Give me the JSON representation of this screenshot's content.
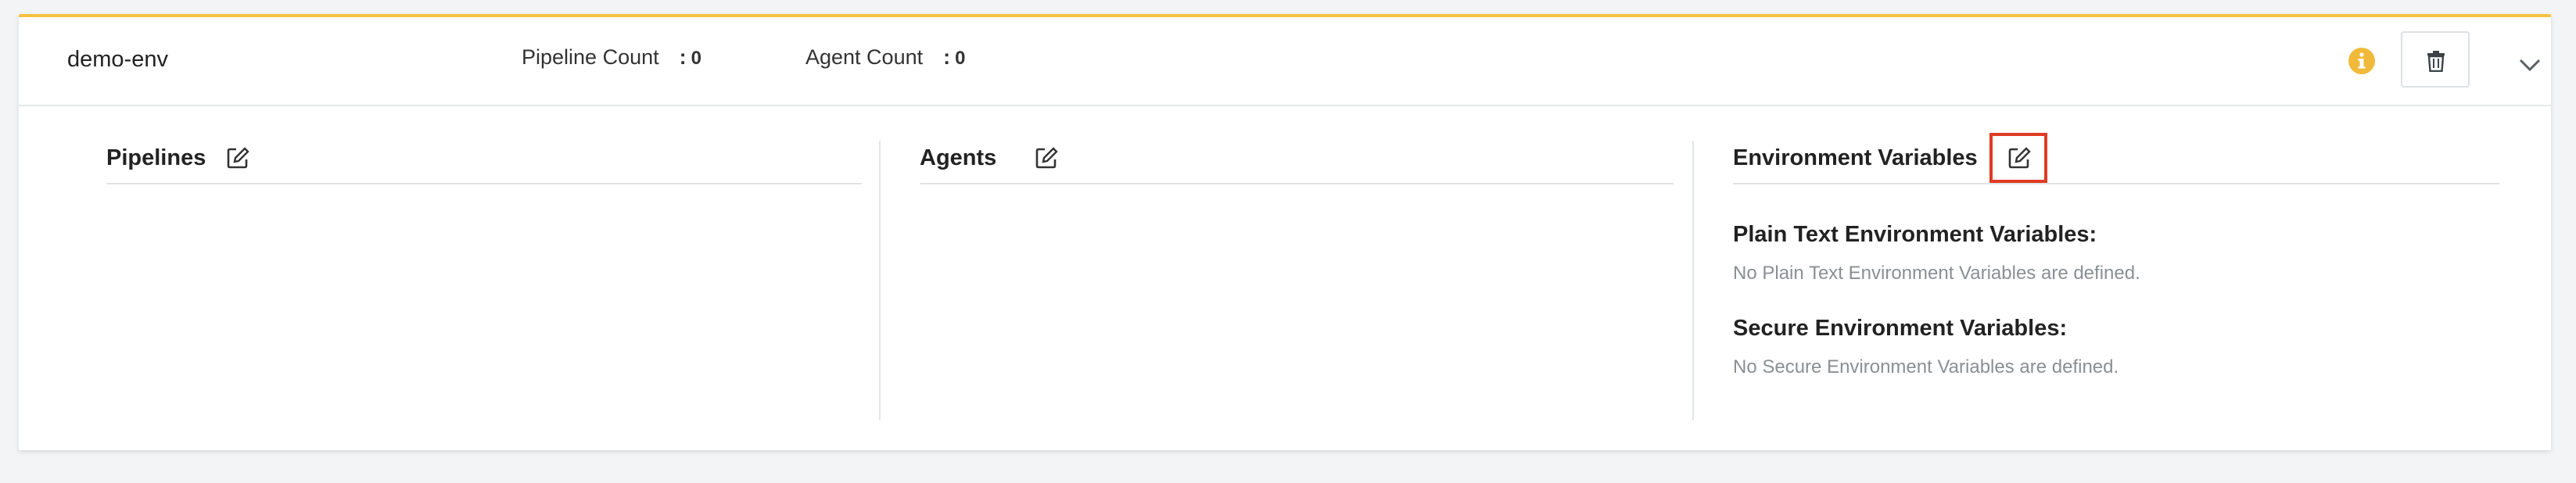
{
  "environment": {
    "name": "demo-env",
    "pipeline_count_label": "Pipeline Count",
    "pipeline_count_value": "0",
    "agent_count_label": "Agent Count",
    "agent_count_value": "0",
    "separator": ":"
  },
  "icons": {
    "info": "info-icon",
    "delete": "trash-icon",
    "collapse": "chevron-down-icon",
    "edit": "edit-icon"
  },
  "colors": {
    "accent_border": "#f5c242",
    "info_icon": "#f0b93a",
    "highlight": "#e03b24"
  },
  "sections": {
    "pipelines": {
      "title": "Pipelines"
    },
    "agents": {
      "title": "Agents"
    },
    "env_vars": {
      "title": "Environment Variables",
      "plain_title": "Plain Text Environment Variables:",
      "plain_empty": "No Plain Text Environment Variables are defined.",
      "secure_title": "Secure Environment Variables:",
      "secure_empty": "No Secure Environment Variables are defined."
    }
  }
}
